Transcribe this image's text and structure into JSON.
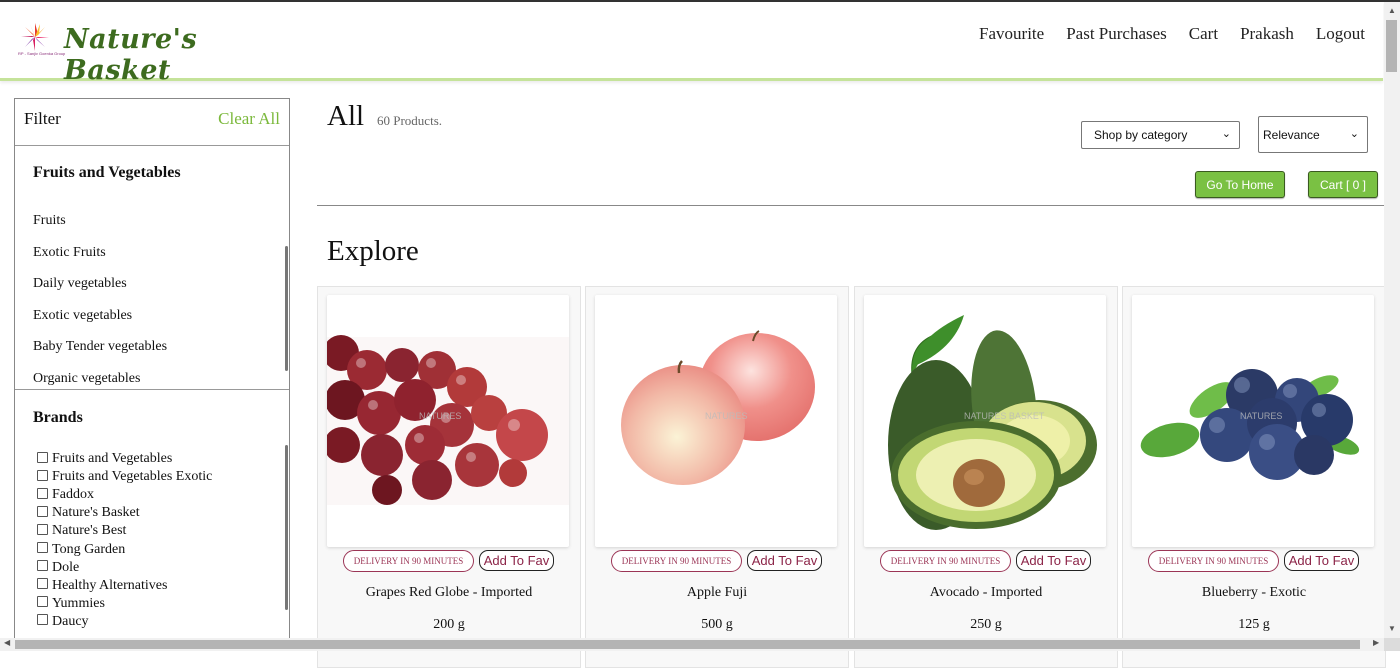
{
  "header": {
    "logo_text": "Nature's Basket",
    "logo_tagline": "RP - Sanjiv Goenka Group",
    "nav": [
      "Favourite",
      "Past Purchases",
      "Cart",
      "Prakash",
      "Logout"
    ]
  },
  "sidebar": {
    "filter_label": "Filter",
    "clear_all": "Clear All",
    "categories_title": "Fruits and Vegetables",
    "categories": [
      "Fruits",
      "Exotic Fruits",
      "Daily vegetables",
      "Exotic vegetables",
      "Baby Tender vegetables",
      "Organic vegetables"
    ],
    "brands_title": "Brands",
    "brands": [
      "Fruits and Vegetables",
      "Fruits and Vegetables Exotic",
      "Faddox",
      "Nature's Basket",
      "Nature's Best",
      "Tong Garden",
      "Dole",
      "Healthy Alternatives",
      "Yummies",
      "Daucy"
    ]
  },
  "main": {
    "title": "All",
    "count": "60 Products.",
    "category_select": "Shop by category",
    "sort_select": "Relevance",
    "go_home": "Go To Home",
    "cart_button": "Cart [ 0 ]",
    "explore": "Explore"
  },
  "products": [
    {
      "name": "Grapes Red Globe - Imported",
      "weight": "200 g",
      "badge": "DELIVERY IN 90 MINUTES",
      "fav": "Add To Fav",
      "watermark": "NATURES"
    },
    {
      "name": "Apple Fuji",
      "weight": "500 g",
      "badge": "DELIVERY IN 90 MINUTES",
      "fav": "Add To Fav",
      "watermark": "NATURES"
    },
    {
      "name": "Avocado - Imported",
      "weight": "250 g",
      "badge": "DELIVERY IN 90 MINUTES",
      "fav": "Add To Fav",
      "watermark": "NATURES BASKET"
    },
    {
      "name": "Blueberry - Exotic",
      "weight": "125 g",
      "badge": "DELIVERY IN 90 MINUTES",
      "fav": "Add To Fav",
      "watermark": "NATURES"
    }
  ],
  "colors": {
    "accent_green": "#7ac143",
    "brand_text": "#3d6b1f",
    "badge_maroon": "#9b3556"
  }
}
